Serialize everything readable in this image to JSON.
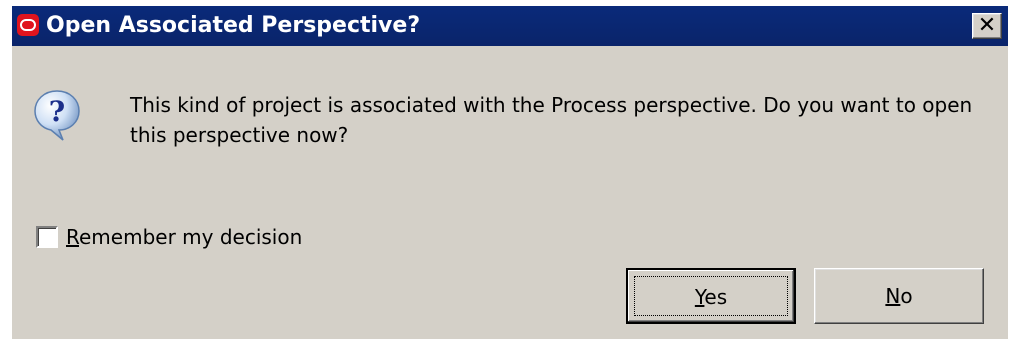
{
  "window": {
    "title": "Open Associated Perspective?",
    "close_glyph": "✕"
  },
  "dialog": {
    "icon": "question-icon",
    "message": "This kind of project is associated with the Process perspective.  Do you want to open this perspective now?",
    "checkbox": {
      "label_mnemonic": "R",
      "label_rest": "emember my decision",
      "checked": false
    },
    "buttons": {
      "yes_mnemonic": "Y",
      "yes_rest": "es",
      "no_mnemonic": "N",
      "no_rest": "o"
    }
  },
  "colors": {
    "titlebar": "#0a246a",
    "title_text": "#ffffff",
    "dialog_bg": "#d4d0c8",
    "app_icon": "#e0141e"
  }
}
